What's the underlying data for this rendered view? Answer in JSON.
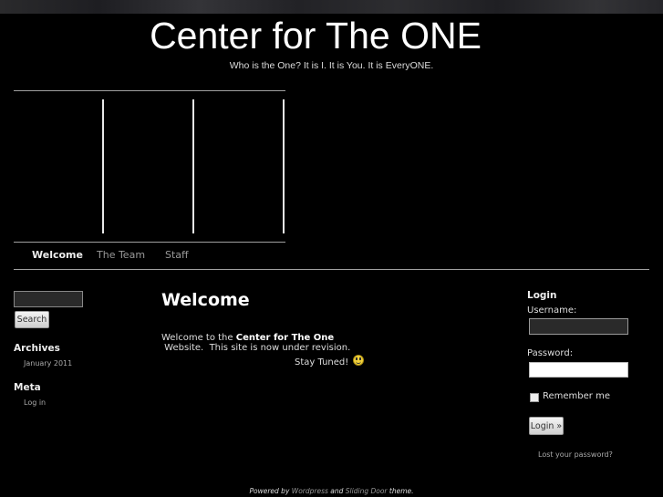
{
  "header": {
    "title": "Center for The ONE",
    "tagline": "Who is the One? It is I. It is You. It is EveryONE."
  },
  "nav": {
    "items": [
      {
        "label": "Welcome",
        "active": true
      },
      {
        "label": "The Team",
        "active": false
      },
      {
        "label": "Staff",
        "active": false
      }
    ]
  },
  "sidebar_left": {
    "search": {
      "value": "",
      "button_label": "Search"
    },
    "archives": {
      "title": "Archives",
      "items": [
        "January 2011"
      ]
    },
    "meta": {
      "title": "Meta",
      "items": [
        "Log in"
      ]
    }
  },
  "post": {
    "title": "Welcome",
    "intro": "Welcome to the ",
    "bold": "Center for The One",
    "rest": " Website.  This site is now under revision.",
    "stay_tuned": "Stay Tuned! ",
    "emoticon": "smiley-icon"
  },
  "login": {
    "title": "Login",
    "username_label": "Username:",
    "username_value": "",
    "password_label": "Password:",
    "password_value": "",
    "remember_label": "Remember me",
    "remember_checked": false,
    "button_label": "Login »",
    "lost_password": "Lost your password?"
  },
  "footer": {
    "powered": "Powered by ",
    "wordpress": "Wordpress",
    "and": " and ",
    "theme_name": "Sliding Door",
    "theme_suffix": " theme."
  }
}
